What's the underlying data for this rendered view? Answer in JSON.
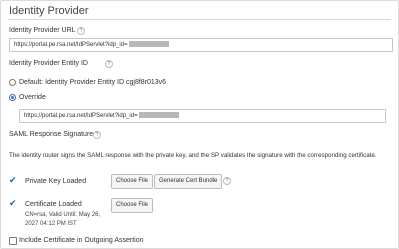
{
  "section_title": "Identity Provider",
  "idp_url": {
    "label": "Identity Provider URL",
    "help": "?",
    "value": "https://portal.pe.rsa.net/IdPServlet?idp_id="
  },
  "entity_id": {
    "label": "Identity Provider Entity ID",
    "help": "?",
    "default_option": "Default: Identity Provider Entity ID cgj8f8r013v6",
    "override_option": "Override",
    "override_value": "https://portal.pe.rsa.net/IdPServlet?idp_id=",
    "selected": "override"
  },
  "saml_signature": {
    "label": "SAML Response Signature",
    "help": "?",
    "description": "The identity router signs the SAML response with the private key, and the SP validates the signature with the corresponding certificate."
  },
  "private_key": {
    "status": "Private Key Loaded",
    "choose_file": "Choose File",
    "generate": "Generate Cert Bundle",
    "help": "?"
  },
  "certificate": {
    "status": "Certificate Loaded",
    "cn": "CN=rsa, Valid Until: May 26,",
    "valid_until": "2027 04:12 PM IST",
    "choose_file": "Choose File"
  },
  "include_cert": {
    "label": "Include Certificate in Outgoing Assertion",
    "checked": false
  },
  "colors": {
    "accent": "#3a6fb0",
    "check": "#2a5c9a",
    "border": "#c8c8c8"
  }
}
